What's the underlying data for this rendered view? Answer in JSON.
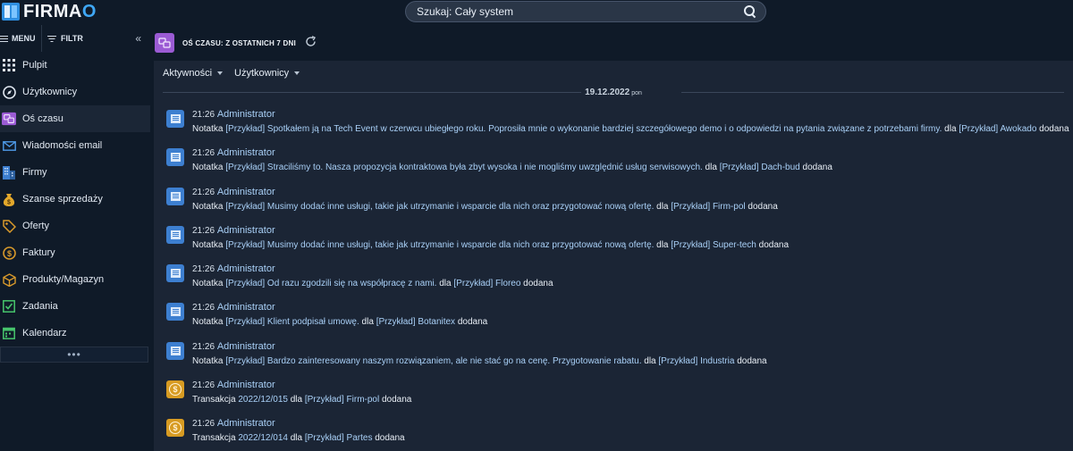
{
  "app": {
    "logo_text": "FIRMA",
    "logo_o": "O"
  },
  "search": {
    "placeholder": "Szukaj: Cały system"
  },
  "sidebar": {
    "menu_label": "MENU",
    "filter_label": "FILTR",
    "collapse_glyph": "«",
    "more_glyph": "•••",
    "items": [
      {
        "label": "Pulpit",
        "icon": "grid-icon"
      },
      {
        "label": "Użytkownicy",
        "icon": "compass-icon"
      },
      {
        "label": "Oś czasu",
        "icon": "timeline-icon",
        "active": true
      },
      {
        "label": "Wiadomości email",
        "icon": "envelope-icon"
      },
      {
        "label": "Firmy",
        "icon": "building-icon"
      },
      {
        "label": "Szanse sprzedaży",
        "icon": "moneybag-icon"
      },
      {
        "label": "Oferty",
        "icon": "tag-icon"
      },
      {
        "label": "Faktury",
        "icon": "coin-icon"
      },
      {
        "label": "Produkty/Magazyn",
        "icon": "box-icon"
      },
      {
        "label": "Zadania",
        "icon": "checkbox-icon"
      },
      {
        "label": "Kalendarz",
        "icon": "calendar-icon"
      }
    ]
  },
  "main": {
    "title": "OŚ CZASU: Z OSTATNICH 7 DNI",
    "filters": [
      "Aktywności",
      "Użytkownicy"
    ],
    "date": "19.12.2022",
    "day": "pon",
    "entries": [
      {
        "type": "note",
        "time": "21:26",
        "author": "Administrator",
        "parts": [
          "Notatka ",
          "[Przykład] Spotkałem ją na Tech Event w czerwcu ubiegłego roku. Poprosiła mnie o wykonanie bardziej szczegółowego demo i o odpowiedzi na pytania związane z potrzebami firmy.",
          " dla ",
          "[Przykład] Awokado",
          " dodana"
        ]
      },
      {
        "type": "note",
        "time": "21:26",
        "author": "Administrator",
        "parts": [
          "Notatka ",
          "[Przykład] Straciliśmy to. Nasza propozycja kontraktowa była zbyt wysoka i nie mogliśmy uwzględnić usług serwisowych.",
          " dla ",
          "[Przykład] Dach-bud",
          " dodana"
        ]
      },
      {
        "type": "note",
        "time": "21:26",
        "author": "Administrator",
        "parts": [
          "Notatka ",
          "[Przykład] Musimy dodać inne usługi, takie jak utrzymanie i wsparcie dla nich oraz przygotować nową ofertę.",
          " dla ",
          "[Przykład] Firm-pol",
          " dodana"
        ]
      },
      {
        "type": "note",
        "time": "21:26",
        "author": "Administrator",
        "parts": [
          "Notatka ",
          "[Przykład] Musimy dodać inne usługi, takie jak utrzymanie i wsparcie dla nich oraz przygotować nową ofertę.",
          " dla ",
          "[Przykład] Super-tech",
          " dodana"
        ]
      },
      {
        "type": "note",
        "time": "21:26",
        "author": "Administrator",
        "parts": [
          "Notatka ",
          "[Przykład] Od razu zgodzili się na współpracę z nami.",
          " dla ",
          "[Przykład] Floreo",
          " dodana"
        ]
      },
      {
        "type": "note",
        "time": "21:26",
        "author": "Administrator",
        "parts": [
          "Notatka ",
          "[Przykład] Klient podpisał umowę.",
          " dla ",
          "[Przykład] Botanitex",
          " dodana"
        ]
      },
      {
        "type": "note",
        "time": "21:26",
        "author": "Administrator",
        "parts": [
          "Notatka ",
          "[Przykład] Bardzo zainteresowany naszym rozwiązaniem, ale nie stać go na cenę. Przygotowanie rabatu.",
          " dla ",
          "[Przykład] Industria",
          " dodana"
        ]
      },
      {
        "type": "money",
        "time": "21:26",
        "author": "Administrator",
        "parts": [
          "Transakcja ",
          "2022/12/015",
          " dla ",
          "[Przykład] Firm-pol",
          " dodana"
        ]
      },
      {
        "type": "money",
        "time": "21:26",
        "author": "Administrator",
        "parts": [
          "Transakcja ",
          "2022/12/014",
          " dla ",
          "[Przykład] Partes",
          " dodana"
        ]
      }
    ]
  },
  "colors": {
    "accent": "#3d7fd0",
    "timeline": "#9b5bd4",
    "money": "#d79b22",
    "link": "#a9d0f7"
  }
}
